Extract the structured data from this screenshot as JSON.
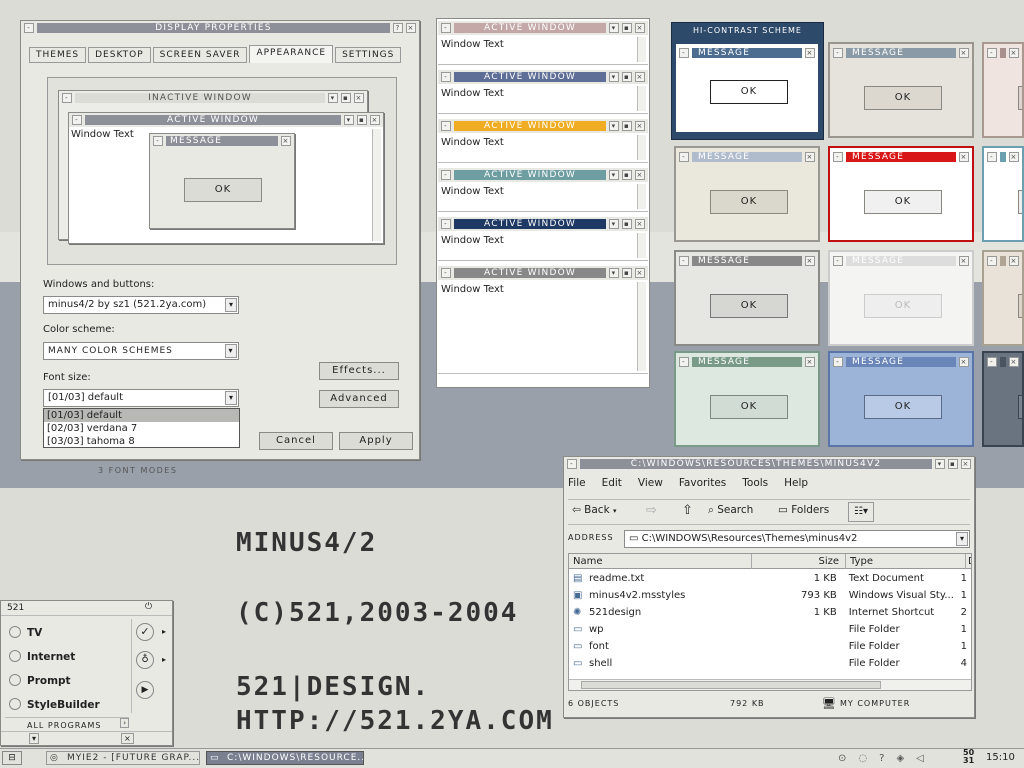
{
  "display_props": {
    "title": "Display Properties",
    "tabs": [
      "Themes",
      "Desktop",
      "Screen Saver",
      "Appearance",
      "Settings"
    ],
    "preview": {
      "inactive_title": "Inactive Window",
      "active_title": "Active Window",
      "window_text": "Window Text",
      "message_title": "Message",
      "ok": "OK"
    },
    "windows_buttons_label": "Windows and buttons:",
    "windows_buttons_value": "minus4/2 by sz1 (521.2ya.com)",
    "color_scheme_label": "Color scheme:",
    "color_scheme_value": "many color schemes",
    "font_size_label": "Font size:",
    "font_size_value": "[01/03] default",
    "font_options": [
      "[01/03] default",
      "[02/03] verdana 7",
      "[03/03] tahoma 8"
    ],
    "effects": "Effects...",
    "advanced": "Advanced",
    "cancel": "Cancel",
    "apply": "Apply",
    "caption": "3 font modes"
  },
  "active_windows": {
    "items": [
      {
        "title": "Active Window",
        "text": "Window Text",
        "color": "#c4a8a8"
      },
      {
        "title": "Active Window",
        "text": "Window Text",
        "color": "#5f6e96"
      },
      {
        "title": "Active Window",
        "text": "Window Text",
        "color": "#f0ac22"
      },
      {
        "title": "Active Window",
        "text": "Window Text",
        "color": "#6f9ea2"
      },
      {
        "title": "Active Window",
        "text": "Window Text",
        "color": "#1e3a64"
      },
      {
        "title": "Active Window",
        "text": "Window Text",
        "color": "#888888"
      }
    ]
  },
  "message_grid": {
    "hicontrast_label": "Hi-contrast scheme",
    "title": "Message",
    "ok": "OK"
  },
  "explorer": {
    "title": "C:\\WINDOWS\\RESOURCES\\THEMES\\MINUS4V2",
    "menu": [
      "File",
      "Edit",
      "View",
      "Favorites",
      "Tools",
      "Help"
    ],
    "back": "Back",
    "search": "Search",
    "folders": "Folders",
    "address_label": "Address",
    "address": "C:\\WINDOWS\\Resources\\Themes\\minus4v2",
    "columns": [
      "Name",
      "Size",
      "Type",
      "D"
    ],
    "rows": [
      {
        "name": "readme.txt",
        "size": "1 KB",
        "type": "Text Document",
        "d": "1",
        "icon": "document-icon"
      },
      {
        "name": "minus4v2.msstyles",
        "size": "793 KB",
        "type": "Windows Visual Sty...",
        "d": "1",
        "icon": "msstyles-icon"
      },
      {
        "name": "521design",
        "size": "1 KB",
        "type": "Internet Shortcut",
        "d": "2",
        "icon": "shortcut-icon"
      },
      {
        "name": "wp",
        "size": "",
        "type": "File Folder",
        "d": "1",
        "icon": "folder-icon"
      },
      {
        "name": "font",
        "size": "",
        "type": "File Folder",
        "d": "1",
        "icon": "folder-icon"
      },
      {
        "name": "shell",
        "size": "",
        "type": "File Folder",
        "d": "4",
        "icon": "folder-icon"
      }
    ],
    "status_objects": "6 objects",
    "status_size": "792 KB",
    "status_location": "My Computer"
  },
  "desktop_text": {
    "line1": "minus4/2",
    "line2": "(c)521,2003-2004",
    "line3": "521|design.",
    "line4": "http://521.2ya.com"
  },
  "start_menu": {
    "user": "521",
    "items": [
      "TV",
      "Internet",
      "Prompt",
      "StyleBuilder"
    ],
    "all_programs": "All programs"
  },
  "taskbar": {
    "tasks": [
      "myIE2 - [Future Grap...",
      "C:\\WINDOWS\\RESOURCE..."
    ],
    "date_top": "50",
    "date_bottom": "31",
    "clock": "15:10"
  }
}
